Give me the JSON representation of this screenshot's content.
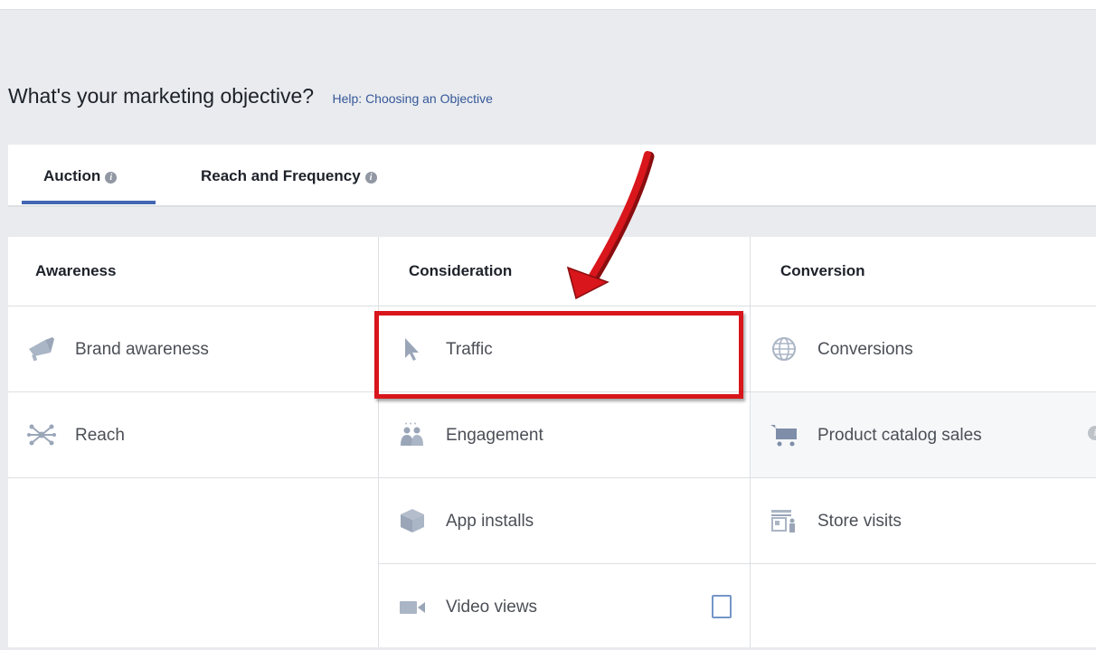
{
  "header": {
    "title": "What's your marketing objective?",
    "help_link": "Help: Choosing an Objective"
  },
  "tabs": [
    {
      "label": "Auction",
      "info_icon": "i",
      "active": true
    },
    {
      "label": "Reach and Frequency",
      "info_icon": "i",
      "active": false
    }
  ],
  "columns": {
    "awareness": {
      "title": "Awareness",
      "items": [
        {
          "label": "Brand awareness",
          "icon": "megaphone-icon"
        },
        {
          "label": "Reach",
          "icon": "reach-star-icon"
        }
      ]
    },
    "consideration": {
      "title": "Consideration",
      "items": [
        {
          "label": "Traffic",
          "icon": "cursor-icon"
        },
        {
          "label": "Engagement",
          "icon": "people-icon"
        },
        {
          "label": "App installs",
          "icon": "box-icon"
        },
        {
          "label": "Video views",
          "icon": "video-camera-icon"
        }
      ]
    },
    "conversion": {
      "title": "Conversion",
      "items": [
        {
          "label": "Conversions",
          "icon": "globe-icon"
        },
        {
          "label": "Product catalog sales",
          "icon": "shopping-cart-icon",
          "info_icon": "i"
        },
        {
          "label": "Store visits",
          "icon": "store-icon"
        }
      ]
    }
  },
  "colors": {
    "accent": "#4267b2",
    "icon_gray": "#9aa6b8",
    "annotation_red": "#d8161b",
    "link": "#365899"
  }
}
